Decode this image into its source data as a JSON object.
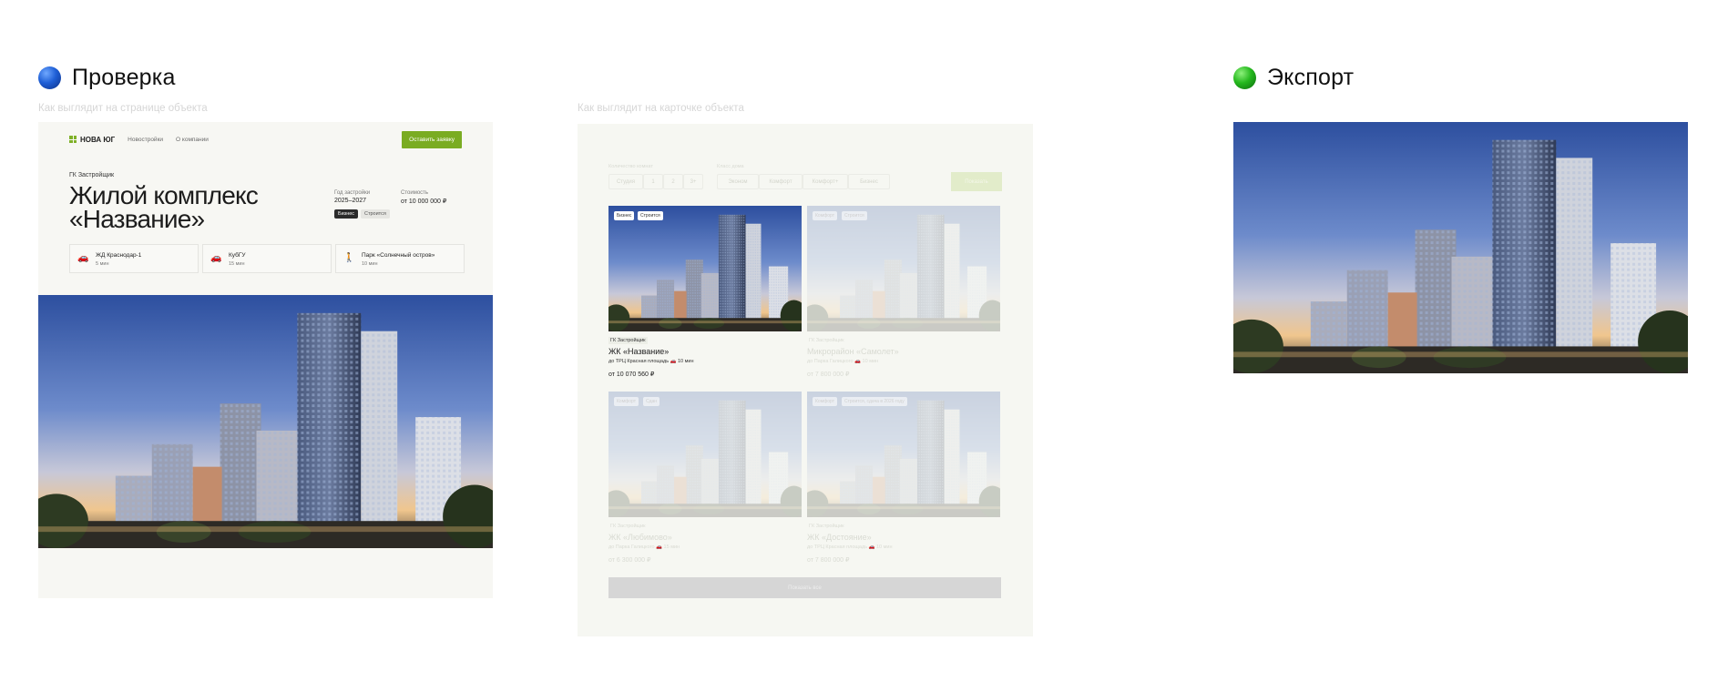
{
  "sections": {
    "check": {
      "title": "Проверка",
      "color": "#1f5fd6"
    },
    "export": {
      "title": "Экспорт",
      "color": "#25b81e"
    }
  },
  "captions": {
    "object_page": "Как выглядит на странице объекта",
    "object_card": "Как выглядит на карточке объекта"
  },
  "object_page": {
    "nav": {
      "logo": "НОВА ЮГ",
      "links": [
        "Новостройки",
        "О компании"
      ],
      "cta": "Оставить заявку"
    },
    "developer": "ГК Застройщик",
    "title_line1": "Жилой комплекс",
    "title_line2": "«Название»",
    "completion_label": "Год застройки",
    "completion_value": "2025–2027",
    "price_label": "Стоимость",
    "price_value": "от 10 000 000 ₽",
    "tags": [
      "Бизнес",
      "Строится"
    ],
    "locations": [
      {
        "icon": "car-icon",
        "glyph": "🚗",
        "name": "ЖД Краснодар-1",
        "time": "5 мин"
      },
      {
        "icon": "car-icon",
        "glyph": "🚗",
        "name": "КубГУ",
        "time": "15 мин"
      },
      {
        "icon": "walk-icon",
        "glyph": "🚶",
        "name": "Парк «Солнечный остров»",
        "time": "10 мин"
      }
    ],
    "accent": "#7aac22"
  },
  "object_card": {
    "filters": {
      "rooms_label": "Количество комнат",
      "class_label": "Класс дома",
      "rooms": [
        "Студия",
        "1",
        "2",
        "3+"
      ],
      "classes": [
        "Эконом",
        "Комфорт",
        "Комфорт+",
        "Бизнес"
      ],
      "show": "Показать"
    },
    "cards": [
      {
        "tags": [
          "Бизнес",
          "Строится"
        ],
        "developer": "ГК Застройщик",
        "name": "ЖК «Название»",
        "location": "до ТРЦ Красная площадь",
        "time": "10 мин",
        "price": "от 10 070 560 ₽",
        "active": true
      },
      {
        "tags": [
          "Комфорт",
          "Строится"
        ],
        "developer": "ГК Застройщик",
        "name": "Микрорайон «Самолет»",
        "location": "до Парка Галицкого",
        "time": "10 мин",
        "price": "от 7 800 000 ₽",
        "active": false
      },
      {
        "tags": [
          "Комфорт",
          "Сдан"
        ],
        "developer": "ГК Застройщик",
        "name": "ЖК «Любимово»",
        "location": "до Парка Галицкого",
        "time": "15 мин",
        "price": "от 6 300 000 ₽",
        "active": false
      },
      {
        "tags": [
          "Комфорт",
          "Строится, сдача в 2026 году"
        ],
        "developer": "ГК Застройщик",
        "name": "ЖК «Достояние»",
        "location": "до ТРЦ Красная площадь",
        "time": "10 мин",
        "price": "от 7 800 000 ₽",
        "active": false
      }
    ],
    "more": "Показать все"
  }
}
